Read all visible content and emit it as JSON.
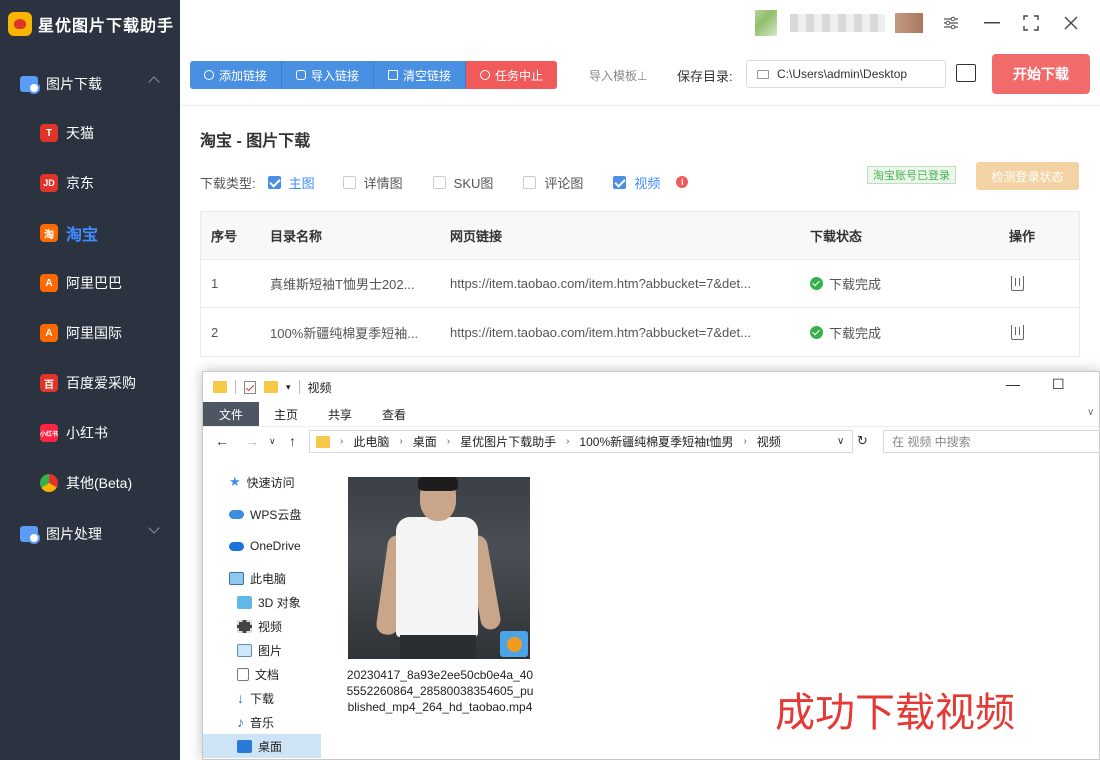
{
  "app": {
    "title": "星优图片下载助手"
  },
  "sidebar": {
    "groups": [
      {
        "label": "图片下载"
      },
      {
        "label": "图片处理"
      }
    ],
    "items": [
      {
        "label": "天猫",
        "icon_text": "T",
        "color": "#e0342a"
      },
      {
        "label": "京东",
        "icon_text": "JD",
        "color": "#e0342a"
      },
      {
        "label": "淘宝",
        "icon_text": "淘",
        "color": "#ff6a00"
      },
      {
        "label": "阿里巴巴",
        "icon_text": "A",
        "color": "#ff6a00"
      },
      {
        "label": "阿里国际",
        "icon_text": "A",
        "color": "#ff6a00"
      },
      {
        "label": "百度爱采购",
        "icon_text": "百",
        "color": "#e0342a"
      },
      {
        "label": "小红书",
        "icon_text": "小红书",
        "color": "#ff2442"
      },
      {
        "label": "其他(Beta)",
        "icon_text": "",
        "color": "#4caf50"
      }
    ]
  },
  "toolbar": {
    "add_link": "添加链接",
    "import_link": "导入链接",
    "clear_link": "清空链接",
    "stop_task": "任务中止",
    "import_template": "导入模板⊥",
    "save_dir_label": "保存目录:",
    "save_dir_value": "C:\\Users\\admin\\Desktop",
    "start_download": "开始下载"
  },
  "main": {
    "title": "淘宝 - 图片下载",
    "type_label": "下载类型:",
    "types": [
      {
        "label": "主图",
        "checked": true
      },
      {
        "label": "详情图",
        "checked": false
      },
      {
        "label": "SKU图",
        "checked": false
      },
      {
        "label": "评论图",
        "checked": false
      },
      {
        "label": "视频",
        "checked": true
      }
    ],
    "login_status": "淘宝账号已登录",
    "check_login": "检测登录状态"
  },
  "table": {
    "headers": [
      "序号",
      "目录名称",
      "网页链接",
      "下载状态",
      "操作"
    ],
    "rows": [
      {
        "index": "1",
        "dir": "真维斯短袖T恤男士202...",
        "url": "https://item.taobao.com/item.htm?abbucket=7&det...",
        "status": "下载完成"
      },
      {
        "index": "2",
        "dir": "100%新疆纯棉夏季短袖...",
        "url": "https://item.taobao.com/item.htm?abbucket=7&det...",
        "status": "下载完成"
      }
    ]
  },
  "explorer": {
    "title": "视频",
    "ribbon_tabs": [
      "文件",
      "主页",
      "共享",
      "查看"
    ],
    "breadcrumb": [
      "此电脑",
      "桌面",
      "星优图片下载助手",
      "100%新疆纯棉夏季短袖t恤男",
      "视频"
    ],
    "search_placeholder": "在 视频 中搜索",
    "nav": [
      {
        "label": "快速访问",
        "icon": "star-icon"
      },
      {
        "label": "WPS云盘",
        "icon": "cloud-icon"
      },
      {
        "label": "OneDrive",
        "icon": "onedrive-icon"
      },
      {
        "label": "此电脑",
        "icon": "computer-icon"
      },
      {
        "label": "3D 对象",
        "icon": "cube-icon"
      },
      {
        "label": "视频",
        "icon": "film-icon"
      },
      {
        "label": "图片",
        "icon": "picture-icon"
      },
      {
        "label": "文档",
        "icon": "document-icon"
      },
      {
        "label": "下载",
        "icon": "download-icon"
      },
      {
        "label": "音乐",
        "icon": "music-icon"
      },
      {
        "label": "桌面",
        "icon": "desktop-icon"
      }
    ],
    "file_name": "20230417_8a93e2ee50cb0e4a_405552260864_28580038354605_published_mp4_264_hd_taobao.mp4",
    "overlay_text": "成功下载视频"
  }
}
